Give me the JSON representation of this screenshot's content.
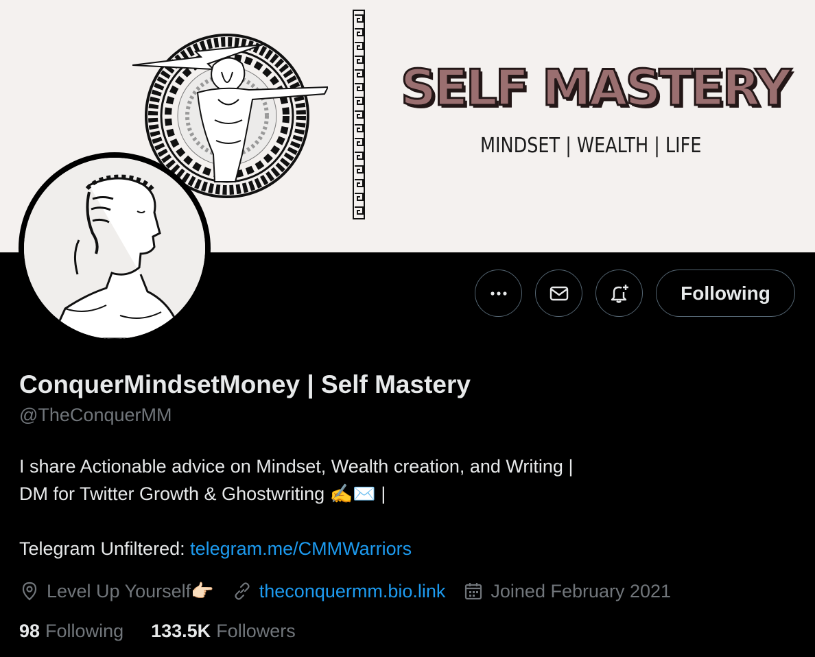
{
  "banner": {
    "title": "SELF MASTERY",
    "subtitle": "MINDSET | WEALTH | LIFE"
  },
  "actions": {
    "more_icon": "more-horizontal-icon",
    "message_icon": "envelope-icon",
    "notify_icon": "bell-plus-icon",
    "follow_label": "Following"
  },
  "profile": {
    "display_name": "ConquerMindsetMoney | Self Mastery",
    "handle": "@TheConquerMM",
    "bio_line1": "I share Actionable advice on Mindset, Wealth creation, and Writing |",
    "bio_line2": "DM for Twitter Growth & Ghostwriting ✍️✉️ |",
    "bio_telegram_label": "Telegram Unfiltered: ",
    "bio_telegram_link": "telegram.me/CMMWarriors",
    "location": "Level Up Yourself👉🏻",
    "website": "theconquermm.bio.link",
    "joined": "Joined February 2021"
  },
  "stats": {
    "following_count": "98",
    "following_label": "Following",
    "followers_count": "133.5K",
    "followers_label": "Followers"
  },
  "colors": {
    "background": "#000000",
    "banner_bg": "#f4f1ef",
    "accent_link": "#1d9bf0",
    "muted_text": "#71767b",
    "banner_title": "#9a6f70"
  }
}
